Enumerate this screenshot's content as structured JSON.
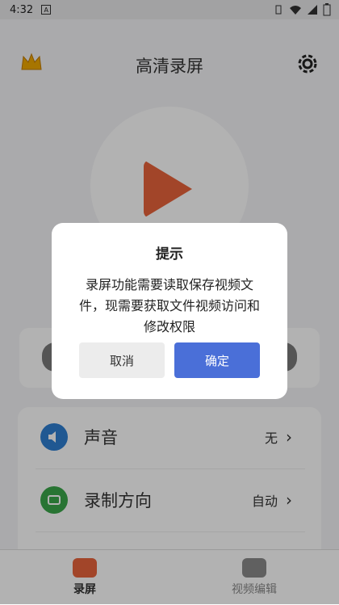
{
  "status_bar": {
    "time": "4:32",
    "notif_icon": "A"
  },
  "header": {
    "title": "高清录屏",
    "crown_icon": "crown-icon",
    "settings_icon": "gear-icon"
  },
  "settings": [
    {
      "label": "声音",
      "value": "无",
      "icon": "speaker-icon",
      "color": "#2f7fd1"
    },
    {
      "label": "录制方向",
      "value": "自动",
      "icon": "screen-rotate-icon",
      "color": "#3aa64a"
    }
  ],
  "tabs": [
    {
      "label": "录屏",
      "icon": "record-camera-icon",
      "active": true
    },
    {
      "label": "视频编辑",
      "icon": "video-edit-icon",
      "active": false
    }
  ],
  "dialog": {
    "title": "提示",
    "message": "录屏功能需要读取保存视频文件，现需要获取文件视频访问和修改权限",
    "cancel": "取消",
    "confirm": "确定"
  },
  "colors": {
    "accent": "#4a6fd8",
    "play": "#e8643c",
    "tab_active": "#e8643c"
  }
}
